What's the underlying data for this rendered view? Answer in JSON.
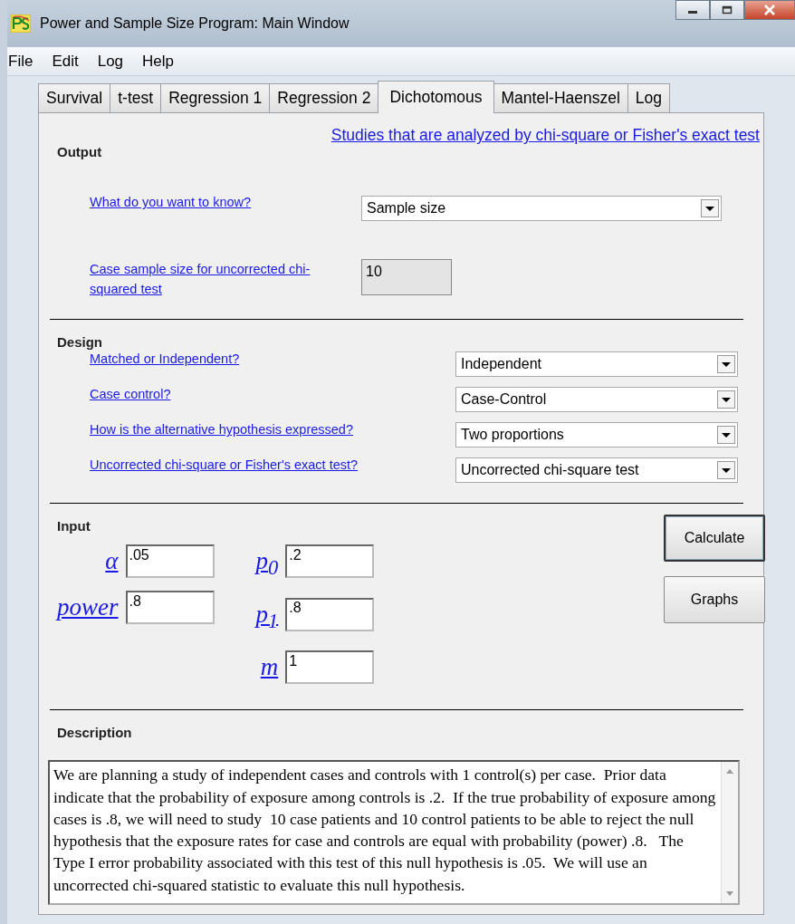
{
  "window": {
    "title": "Power and Sample Size Program:  Main Window"
  },
  "menu": [
    "File",
    "Edit",
    "Log",
    "Help"
  ],
  "tabs": [
    {
      "label": "Survival",
      "selected": false
    },
    {
      "label": "t-test",
      "selected": false
    },
    {
      "label": "Regression 1",
      "selected": false
    },
    {
      "label": "Regression 2",
      "selected": false
    },
    {
      "label": "Dichotomous",
      "selected": true
    },
    {
      "label": "Mantel-Haenszel",
      "selected": false
    },
    {
      "label": "Log",
      "selected": false
    }
  ],
  "help_link": "Studies that are analyzed by chi-square or Fisher's exact test",
  "output": {
    "heading": "Output",
    "rows": [
      {
        "kind": "dropdown",
        "label": " What do you want to know?",
        "value": "Sample size"
      },
      {
        "kind": "readout",
        "label": "Case sample size for uncorrected chi-squared test",
        "value": "10"
      }
    ]
  },
  "design": {
    "heading": "Design",
    "rows": [
      {
        "label": "Matched or Independent?",
        "value": "Independent"
      },
      {
        "label": "Case control?",
        "value": "Case-Control"
      },
      {
        "label": "How is the alternative hypothesis expressed?",
        "value": "Two proportions"
      },
      {
        "label": "Uncorrected chi-square or Fisher's exact test?",
        "value": "Uncorrected chi-square test"
      }
    ]
  },
  "input": {
    "heading": "Input",
    "left": [
      {
        "label": "α",
        "value": ".05"
      },
      {
        "label": "power",
        "value": ".8"
      }
    ],
    "right": [
      {
        "label": "p$_{0}$",
        "value": ".2"
      },
      {
        "label": "p$_{1}$",
        "value": ".8"
      },
      {
        "label": "m",
        "value": "1"
      }
    ],
    "buttons": [
      {
        "label": "Calculate",
        "default": true
      },
      {
        "label": "Graphs",
        "default": false
      }
    ]
  },
  "description": {
    "heading": "Description",
    "text": "We are planning a study of independent cases and controls with 1 control(s) per case.  Prior data indicate that the probability of exposure among controls is .2.  If the true probability of exposure among cases is .8, we will need to study  10 case patients and 10 control patients to be able to reject the null hypothesis that the exposure rates for case and controls are equal with probability (power) .8.   The Type I error probability associated with this test of this null hypothesis is .05.  We will use an uncorrected chi-squared statistic to evaluate this null hypothesis."
  }
}
